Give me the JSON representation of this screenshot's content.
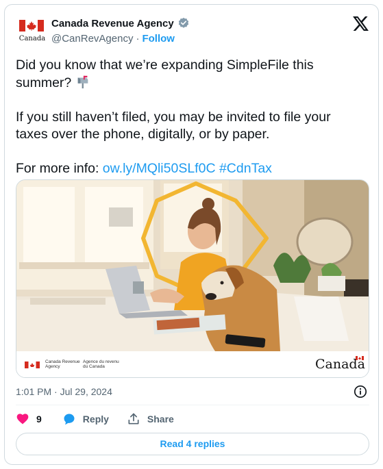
{
  "author": {
    "name": "Canada Revenue Agency",
    "handle": "@CanRevAgency",
    "separator": "·",
    "follow_label": "Follow",
    "avatar_wordmark": "Canada"
  },
  "tweet": {
    "line1": "Did you know that we’re expanding SimpleFile this summer?",
    "line2": "If you still haven’t filed, you may be invited to file your taxes over the phone, digitally, or by paper.",
    "line3_prefix": "For more info:",
    "link": "ow.ly/MQli50SLf0C",
    "hashtag": "#CdnTax"
  },
  "media": {
    "footer_en": "Canada Revenue Agency",
    "footer_fr": "Agence du revenu du Canada",
    "wordmark": "Canada"
  },
  "timestamp": "1:01 PM · Jul 29, 2024",
  "actions": {
    "like_count": "9",
    "reply_label": "Reply",
    "share_label": "Share"
  },
  "read_replies_label": "Read 4 replies",
  "colors": {
    "accent": "#1d9bf0",
    "like": "#f91880",
    "text": "#0f1419",
    "muted": "#536471",
    "border": "#cfd9de"
  },
  "icons": [
    "verified-badge-icon",
    "x-logo-icon",
    "mailbox-icon",
    "info-icon",
    "heart-icon",
    "reply-bubble-icon",
    "share-icon"
  ]
}
